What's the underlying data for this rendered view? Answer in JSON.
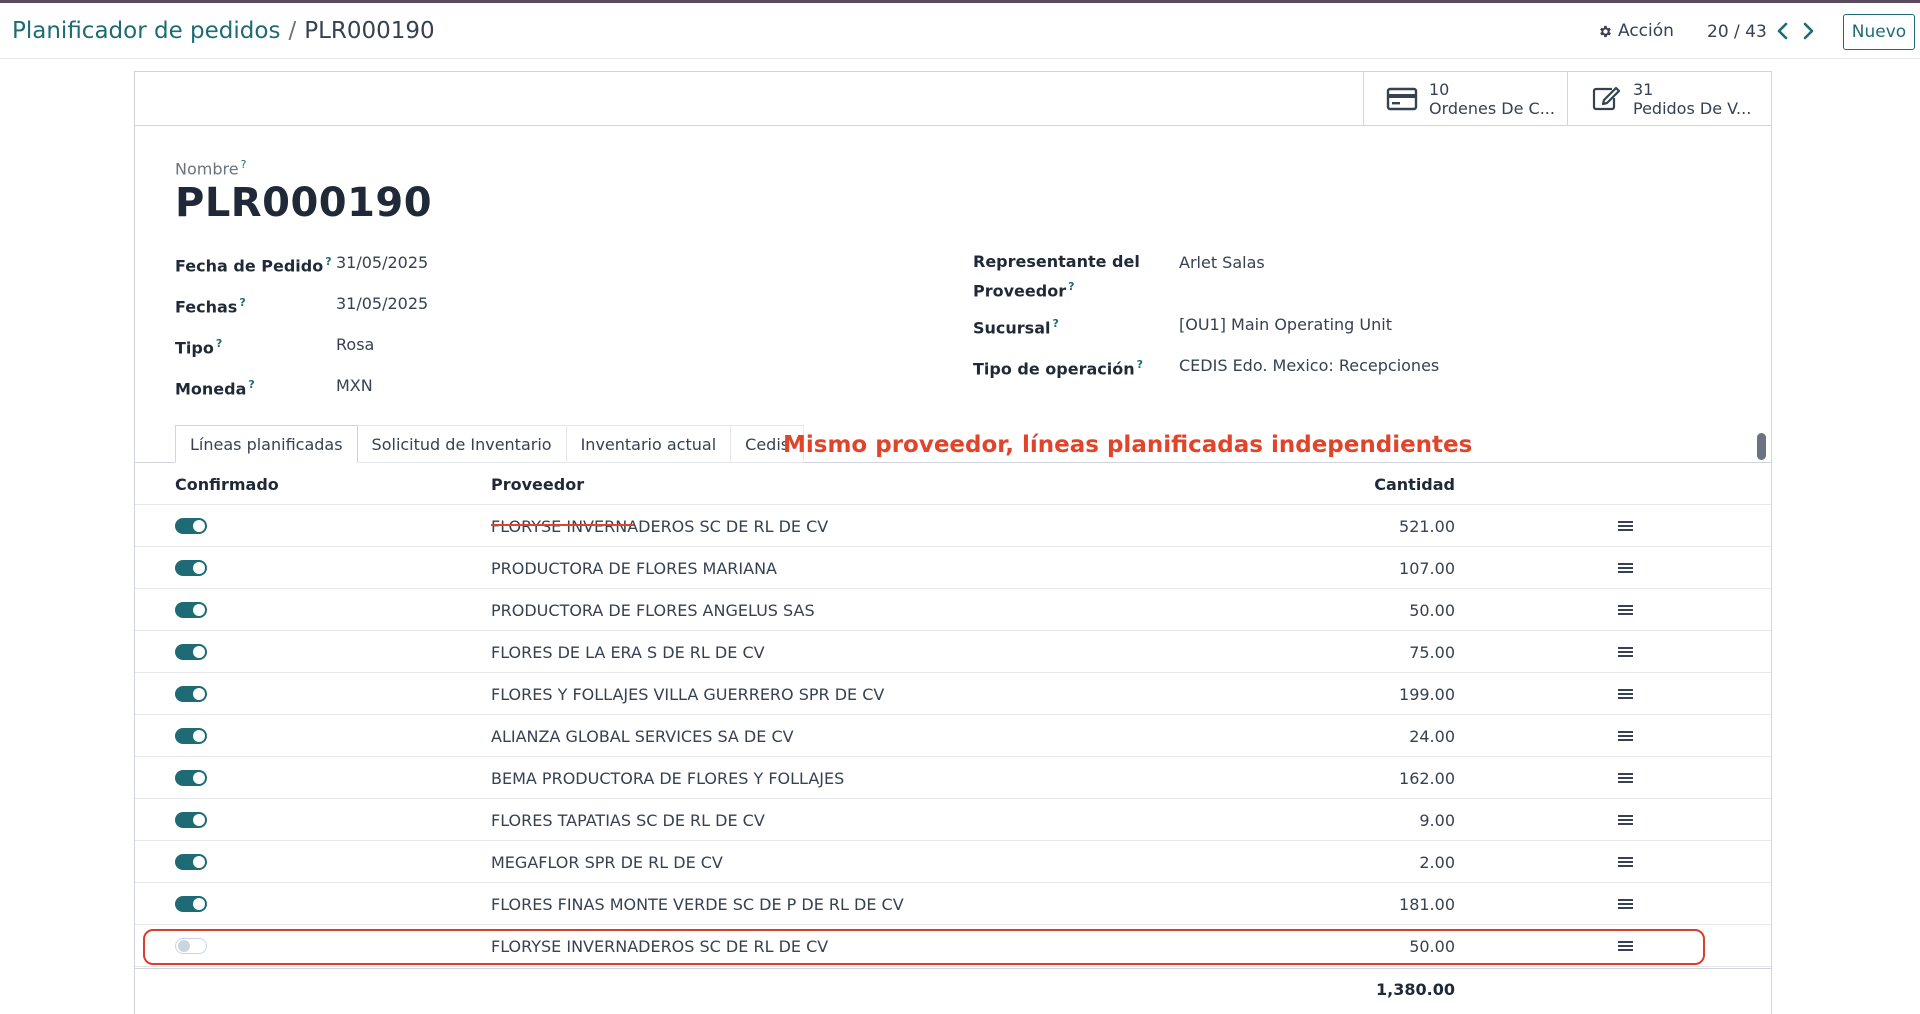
{
  "header": {
    "breadcrumb_parent": "Planificador de pedidos",
    "breadcrumb_separator": "/",
    "breadcrumb_current": "PLR000190",
    "action_label": "Acción",
    "pager": "20 / 43",
    "new_label": "Nuevo"
  },
  "smart_buttons": [
    {
      "value": "10",
      "label": "Ordenes De C...",
      "icon": "credit-card-icon"
    },
    {
      "value": "31",
      "label": "Pedidos De V...",
      "icon": "edit-icon"
    }
  ],
  "form": {
    "name_label": "Nombre",
    "name_value": "PLR000190",
    "help_mark": "?",
    "fields_left": [
      {
        "label": "Fecha de Pedido",
        "value": "31/05/2025"
      },
      {
        "label": "Fechas",
        "value": "31/05/2025"
      },
      {
        "label": "Tipo",
        "value": "Rosa"
      },
      {
        "label": "Moneda",
        "value": "MXN"
      }
    ],
    "fields_right": [
      {
        "label_line1": "Representante del",
        "label_line2": "Proveedor",
        "value": "Arlet Salas"
      },
      {
        "label": "Sucursal",
        "value": "[OU1] Main Operating Unit"
      },
      {
        "label": "Tipo de operación",
        "value": "CEDIS Edo. Mexico: Recepciones"
      }
    ]
  },
  "tabs": [
    "Líneas planificadas",
    "Solicitud de Inventario",
    "Inventario actual",
    "Cedis"
  ],
  "annotation": "Mismo proveedor, líneas planificadas independientes",
  "colors": {
    "accent": "#1e6b75",
    "annotation": "#e0452b"
  },
  "list": {
    "headers": {
      "confirmed": "Confirmado",
      "vendor": "Proveedor",
      "quantity": "Cantidad"
    },
    "rows": [
      {
        "confirmed": true,
        "vendor": "FLORYSE INVERNADEROS SC DE RL DE CV",
        "qty": "521.00"
      },
      {
        "confirmed": true,
        "vendor": "PRODUCTORA DE FLORES MARIANA",
        "qty": "107.00"
      },
      {
        "confirmed": true,
        "vendor": "PRODUCTORA DE FLORES ANGELUS SAS",
        "qty": "50.00"
      },
      {
        "confirmed": true,
        "vendor": "FLORES DE LA ERA S DE RL DE CV",
        "qty": "75.00"
      },
      {
        "confirmed": true,
        "vendor": "FLORES Y FOLLAJES VILLA GUERRERO SPR DE CV",
        "qty": "199.00"
      },
      {
        "confirmed": true,
        "vendor": "ALIANZA GLOBAL SERVICES SA DE CV",
        "qty": "24.00"
      },
      {
        "confirmed": true,
        "vendor": "BEMA PRODUCTORA DE FLORES Y FOLLAJES",
        "qty": "162.00"
      },
      {
        "confirmed": true,
        "vendor": "FLORES TAPATIAS SC DE RL DE CV",
        "qty": "9.00"
      },
      {
        "confirmed": true,
        "vendor": "MEGAFLOR SPR DE RL DE CV",
        "qty": "2.00"
      },
      {
        "confirmed": true,
        "vendor": "FLORES FINAS MONTE VERDE SC DE P DE RL DE CV",
        "qty": "181.00"
      },
      {
        "confirmed": false,
        "vendor": "FLORYSE INVERNADEROS SC DE RL DE CV",
        "qty": "50.00"
      }
    ],
    "total": "1,380.00"
  }
}
